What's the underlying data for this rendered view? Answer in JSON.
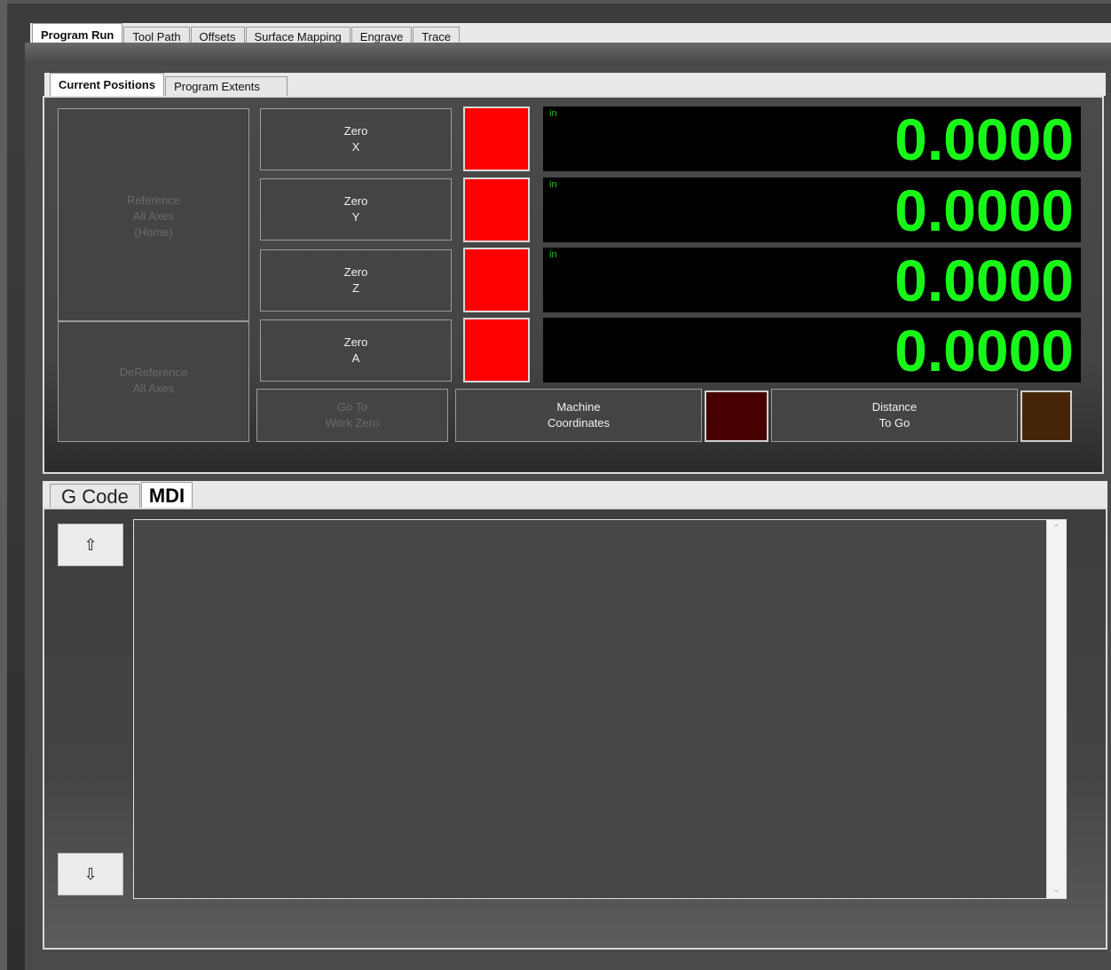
{
  "main_tabs": [
    "Program Run",
    "Tool Path",
    "Offsets",
    "Surface Mapping",
    "Engrave",
    "Trace"
  ],
  "sub_tabs": [
    "Current Positions",
    "Program Extents"
  ],
  "reference_button": {
    "line1": "Reference",
    "line2": "All Axes",
    "line3": "(Home)"
  },
  "dereference_button": {
    "line1": "DeReference",
    "line2": "All Axes"
  },
  "axes": [
    {
      "zero_label": "Zero",
      "axis": "X",
      "unit": "in",
      "value": "0.0000"
    },
    {
      "zero_label": "Zero",
      "axis": "Y",
      "unit": "in",
      "value": "0.0000"
    },
    {
      "zero_label": "Zero",
      "axis": "Z",
      "unit": "in",
      "value": "0.0000"
    },
    {
      "zero_label": "Zero",
      "axis": "A",
      "unit": "",
      "value": "0.0000"
    }
  ],
  "goto_button": {
    "line1": "Go To",
    "line2": "Work Zero"
  },
  "machine_coords": {
    "line1": "Machine",
    "line2": "Coordinates"
  },
  "distance_to_go": {
    "line1": "Distance",
    "line2": "To Go"
  },
  "bottom_tabs": [
    "G Code",
    "MDI"
  ],
  "arrows": {
    "up": "⇧",
    "down": "⇩"
  },
  "colors": {
    "axis_led": "#ff0000",
    "machine_coords_led": "#460000",
    "distance_to_go_led": "#462508",
    "dro_text": "#19f719"
  }
}
